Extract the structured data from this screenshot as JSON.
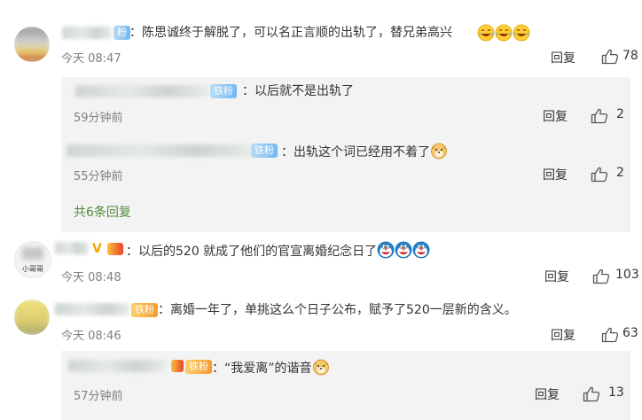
{
  "comments": [
    {
      "badge": "粉",
      "text": "：陈思诚终于解脱了，可以名正言顺的出轨了，替兄弟高兴",
      "emoji": [
        "laugh-cry",
        "laugh-cry",
        "laugh-cry"
      ],
      "time": "今天 08:47",
      "reply_label": "回复",
      "likes": "78",
      "replies": [
        {
          "badge": "铁粉",
          "text": "：以后就不是出轨了",
          "time": "59分钟前",
          "reply_label": "回复",
          "likes": "2"
        },
        {
          "badge": "铁粉",
          "text": "：出轨这个词已经用不着了",
          "emoji": [
            "doge"
          ],
          "time": "55分钟前",
          "reply_label": "回复",
          "likes": "2"
        }
      ],
      "more_replies": "共6条回复"
    },
    {
      "avatar_caption": "小哥哥",
      "text": "：以后的520 就成了他们的官宣离婚纪念日了",
      "emoji": [
        "doraemon",
        "doraemon",
        "doraemon"
      ],
      "time": "今天 08:48",
      "reply_label": "回复",
      "likes": "103"
    },
    {
      "badge": "铁粉",
      "text": "：离婚一年了，单挑这么个日子公布，赋予了520一层新的含义。",
      "time": "今天 08:46",
      "reply_label": "回复",
      "likes": "63",
      "replies": [
        {
          "badge": "铁粉",
          "text": "：“我爱离”的谐音",
          "emoji": [
            "doge"
          ],
          "time": "57分钟前",
          "reply_label": "回复",
          "likes": "13"
        }
      ]
    }
  ],
  "colors": {
    "badge_blue": "#72b7ef",
    "more_green": "#4f8b3b",
    "reply_bg": "#f3f3f3"
  }
}
